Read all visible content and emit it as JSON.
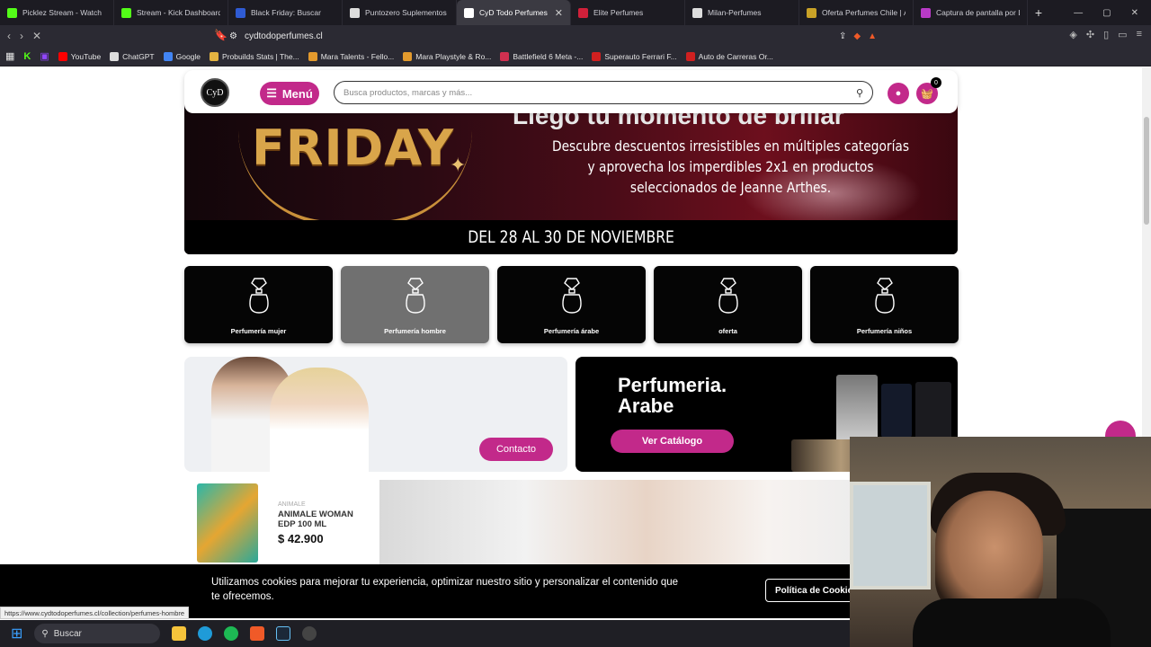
{
  "browser": {
    "tabs": [
      {
        "title": "Picklez Stream - Watch",
        "color": "#53fc18"
      },
      {
        "title": "Stream - Kick Dashboard",
        "color": "#53fc18"
      },
      {
        "title": "Black Friday: Buscar",
        "color": "#2f5bd3"
      },
      {
        "title": "Puntozero Suplementos |",
        "color": "#dddddd"
      },
      {
        "title": "CyD Todo Perfumes",
        "color": "#ffffff"
      },
      {
        "title": "Elite Perfumes",
        "color": "#d0203a"
      },
      {
        "title": "Milan-Perfumes",
        "color": "#dddddd"
      },
      {
        "title": "Oferta Perfumes Chile | Ár",
        "color": "#c9a227"
      },
      {
        "title": "Captura de pantalla por L",
        "color": "#b93ac7"
      }
    ],
    "active_tab_index": 4,
    "url": "cydtodoperfumes.cl",
    "bookmarks": [
      {
        "label": "YouTube",
        "color": "#ff0000"
      },
      {
        "label": "ChatGPT",
        "color": "#dddddd"
      },
      {
        "label": "Google",
        "color": "#4285f4"
      },
      {
        "label": "Probuilds Stats | The...",
        "color": "#e3b341"
      },
      {
        "label": "Mara Talents - Fello...",
        "color": "#e39a2d"
      },
      {
        "label": "Mara Playstyle & Ro...",
        "color": "#e39a2d"
      },
      {
        "label": "Battlefield 6 Meta -...",
        "color": "#d03050"
      },
      {
        "label": "Superauto Ferrari F...",
        "color": "#d02020"
      },
      {
        "label": "Auto de Carreras Or...",
        "color": "#d02020"
      }
    ]
  },
  "site": {
    "logo_text": "CyD",
    "menu_label": "Menú",
    "search_placeholder": "Busca productos, marcas y más...",
    "cart_count": "0",
    "accent": "#c2298a",
    "banner": {
      "friday_text": "FRIDAY",
      "top_cut_text": "Llegó tu momento de brillar",
      "promo_text": "Descubre descuentos irresistibles en múltiples categorías y aprovecha los imperdibles 2x1 en productos seleccionados de Jeanne Arthes.",
      "date_text": "DEL 28 AL 30 DE NOVIEMBRE"
    },
    "categories": [
      {
        "label": "Perfumería mujer"
      },
      {
        "label": "Perfumería hombre"
      },
      {
        "label": "Perfumería árabe"
      },
      {
        "label": "oferta"
      },
      {
        "label": "Perfumería niños"
      }
    ],
    "promo_left": {
      "button": "Contacto"
    },
    "promo_right": {
      "title_line1": "Perfumeria.",
      "title_line2": "Arabe",
      "button": "Ver Catálogo"
    },
    "product": {
      "brand": "ANIMALE",
      "name": "ANIMALE WOMAN EDP 100 ML",
      "price": "$ 42.900"
    },
    "cookie": {
      "text": "Utilizamos cookies para mejorar tu experiencia, optimizar nuestro sitio y personalizar el contenido que te ofrecemos.",
      "button": "Política de Cookies"
    }
  },
  "status_url": "https://www.cydtodoperfumes.cl/collection/perfumes-hombre",
  "taskbar": {
    "search_label": "Buscar"
  }
}
